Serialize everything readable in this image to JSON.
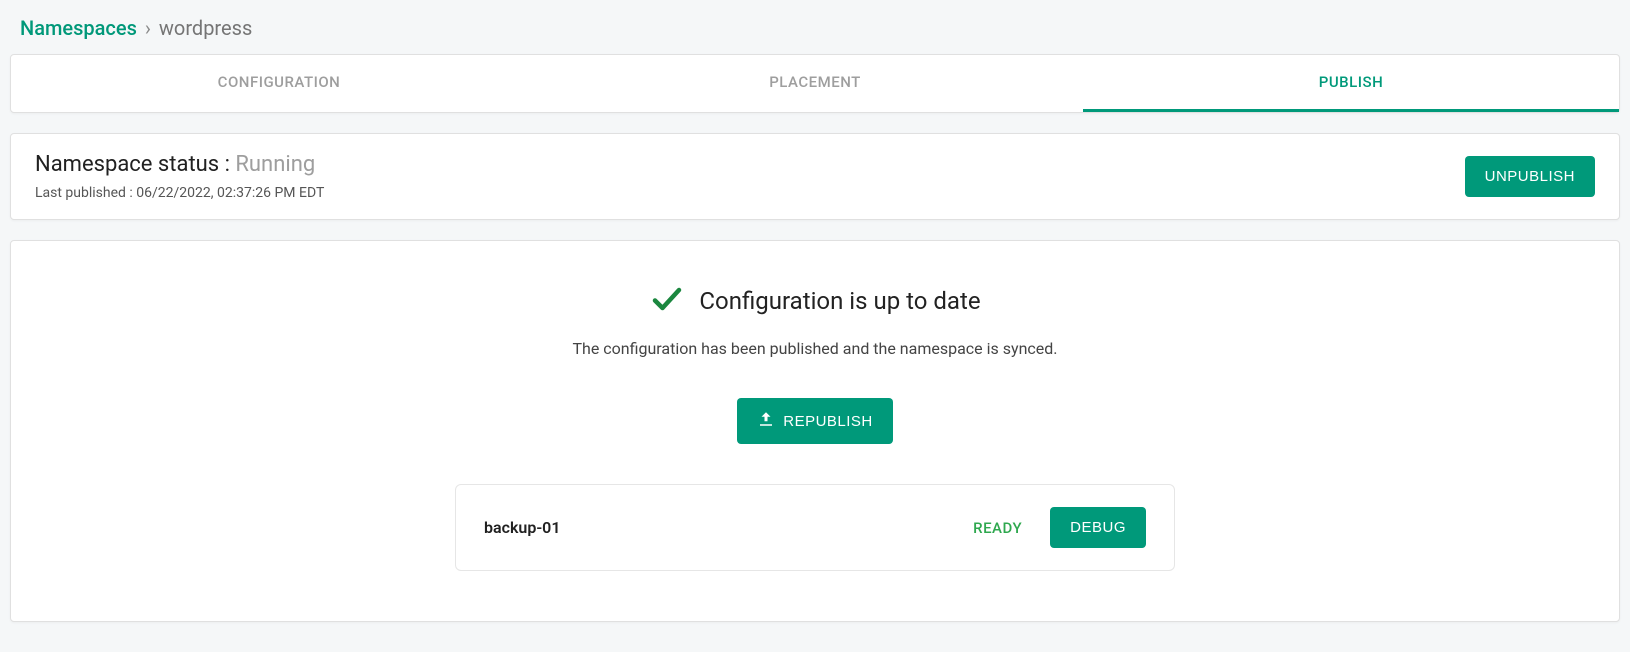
{
  "breadcrumb": {
    "root": "Namespaces",
    "separator": "›",
    "current": "wordpress"
  },
  "tabs": [
    {
      "label": "CONFIGURATION"
    },
    {
      "label": "PLACEMENT"
    },
    {
      "label": "PUBLISH"
    }
  ],
  "status": {
    "label": "Namespace status : ",
    "value": "Running",
    "last_published_label": "Last published : ",
    "last_published_value": "06/22/2022, 02:37:26 PM EDT",
    "unpublish_label": "UNPUBLISH"
  },
  "config": {
    "title": "Configuration is up to date",
    "description": "The configuration has been published and the namespace is synced.",
    "republish_label": "REPUBLISH"
  },
  "backups": [
    {
      "name": "backup-01",
      "status": "READY",
      "action": "DEBUG"
    }
  ]
}
